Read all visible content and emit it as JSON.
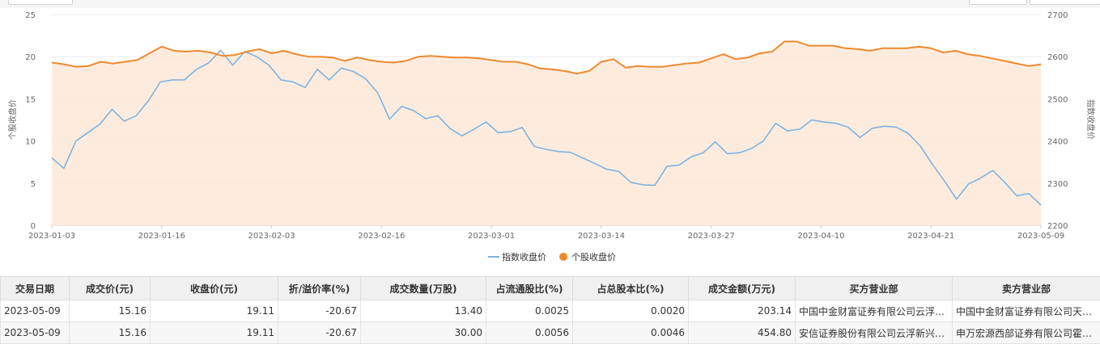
{
  "chart_data": {
    "type": "line",
    "y_left": {
      "min": 0,
      "max": 25,
      "ticks": [
        0,
        5,
        10,
        15,
        20,
        25
      ],
      "label": "个股收盘价"
    },
    "y_right": {
      "min": 2200,
      "max": 2700,
      "ticks": [
        2200,
        2300,
        2400,
        2500,
        2600,
        2700
      ],
      "label": "指数收盘价"
    },
    "x_tick_labels": [
      "2023-01-03",
      "2023-01-16",
      "2023-02-03",
      "2023-02-16",
      "2023-03-01",
      "2023-03-14",
      "2023-03-27",
      "2023-04-10",
      "2023-04-21",
      "2023-05-09"
    ],
    "grid": true,
    "legend_position": "bottom",
    "series": [
      {
        "name": "指数收盘价",
        "axis": "right",
        "color": "#7eb3e0",
        "values": [
          2360,
          2335,
          2400,
          2420,
          2440,
          2475,
          2447,
          2460,
          2495,
          2540,
          2545,
          2545,
          2570,
          2585,
          2615,
          2580,
          2612,
          2600,
          2580,
          2545,
          2540,
          2527,
          2570,
          2545,
          2573,
          2565,
          2548,
          2515,
          2452,
          2482,
          2472,
          2453,
          2460,
          2430,
          2412,
          2428,
          2445,
          2420,
          2422,
          2432,
          2387,
          2380,
          2375,
          2373,
          2360,
          2347,
          2333,
          2328,
          2302,
          2296,
          2295,
          2340,
          2343,
          2362,
          2372,
          2398,
          2370,
          2372,
          2382,
          2400,
          2442,
          2424,
          2428,
          2450,
          2445,
          2442,
          2433,
          2408,
          2430,
          2435,
          2433,
          2418,
          2388,
          2345,
          2305,
          2262,
          2298,
          2312,
          2330,
          2302,
          2270,
          2275,
          2248
        ]
      },
      {
        "name": "个股收盘价",
        "axis": "left",
        "color": "#ed8a2f",
        "values": [
          19.3,
          19.1,
          18.8,
          18.9,
          19.4,
          19.2,
          19.4,
          19.6,
          20.4,
          21.2,
          20.7,
          20.6,
          20.7,
          20.5,
          20.1,
          20.2,
          20.6,
          20.9,
          20.4,
          20.7,
          20.3,
          20.0,
          20.0,
          19.9,
          19.5,
          19.9,
          19.6,
          19.4,
          19.3,
          19.5,
          20.0,
          20.1,
          20.0,
          19.9,
          19.9,
          19.8,
          19.6,
          19.4,
          19.4,
          19.1,
          18.6,
          18.5,
          18.3,
          18.0,
          18.3,
          19.4,
          19.7,
          18.7,
          18.9,
          18.8,
          18.8,
          19.0,
          19.2,
          19.3,
          19.8,
          20.3,
          19.7,
          19.9,
          20.4,
          20.6,
          21.8,
          21.8,
          21.3,
          21.3,
          21.3,
          21.0,
          20.9,
          20.7,
          21.0,
          21.0,
          21.0,
          21.2,
          21.0,
          20.5,
          20.7,
          20.3,
          20.1,
          19.8,
          19.5,
          19.2,
          18.9,
          19.1
        ]
      }
    ]
  },
  "table": {
    "headers": [
      "交易日期",
      "成交价(元)",
      "收盘价(元)",
      "折/溢价率(%)",
      "成交数量(万股)",
      "占流通股比(%)",
      "占总股本比(%)",
      "成交金额(万元)",
      "买方营业部",
      "卖方营业部"
    ],
    "rows": [
      [
        "2023-05-09",
        "15.16",
        "19.11",
        "-20.67",
        "13.40",
        "0.0025",
        "0.0020",
        "203.14",
        "中国中金财富证券有限公司云浮…",
        "中国中金财富证券有限公司天津…"
      ],
      [
        "2023-05-09",
        "15.16",
        "19.11",
        "-20.67",
        "30.00",
        "0.0056",
        "0.0046",
        "454.80",
        "安信证券股份有限公司云浮新兴…",
        "申万宏源西部证券有限公司霍尔…"
      ]
    ]
  }
}
